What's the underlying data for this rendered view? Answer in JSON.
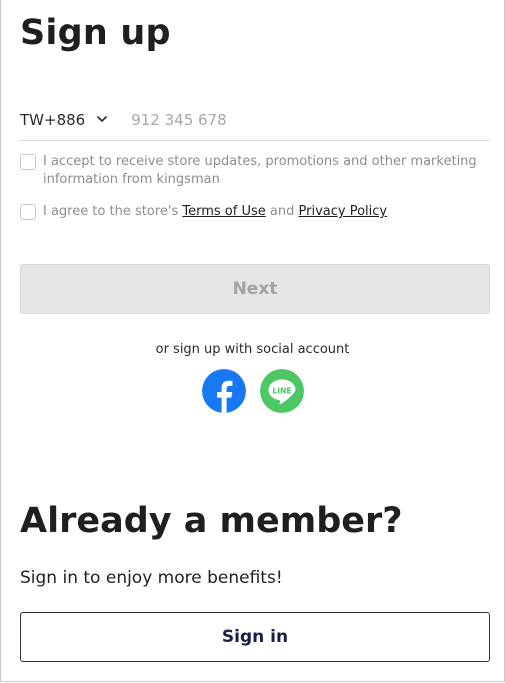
{
  "signup": {
    "title": "Sign up",
    "country_code": "TW+886",
    "phone_placeholder": "912 345 678",
    "marketing_consent": "I accept to receive store updates, promotions and other marketing information from kingsman",
    "terms_prefix": "I agree to the store's ",
    "terms_link": "Terms of Use",
    "terms_and": " and ",
    "privacy_link": "Privacy Policy",
    "next_label": "Next",
    "social_label": "or sign up with social account",
    "social": {
      "facebook_icon": "facebook-icon",
      "line_icon": "line-icon",
      "line_text": "LINE"
    }
  },
  "member": {
    "title": "Already a member?",
    "subtitle": "Sign in to enjoy more benefits!",
    "signin_label": "Sign in"
  },
  "colors": {
    "facebook": "#1877F2",
    "line": "#4CC764",
    "next_disabled_bg": "#e5e5e5",
    "signin_text": "#1b1f4a"
  }
}
